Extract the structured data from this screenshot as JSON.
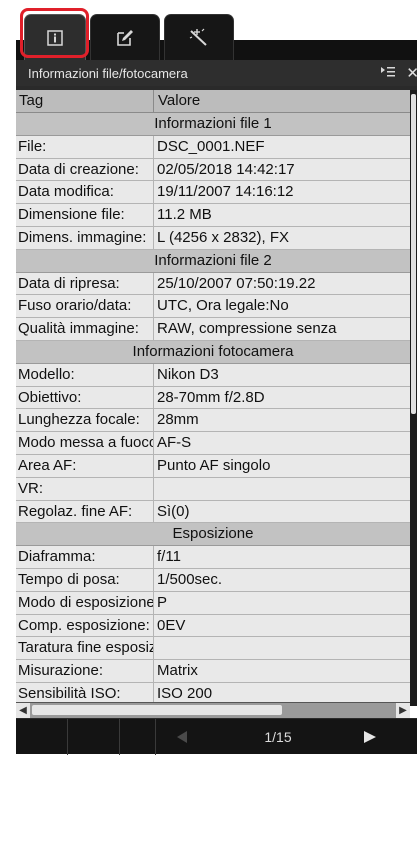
{
  "tabs": [
    {
      "name": "info-tab",
      "icon": "info-icon",
      "selected": true
    },
    {
      "name": "edit-tab",
      "icon": "edit-icon",
      "selected": false
    },
    {
      "name": "adjust-tab",
      "icon": "magic-wand-icon",
      "selected": false
    }
  ],
  "header": {
    "title": "Informazioni file/fotocamera",
    "menu_icon": "list-menu-icon",
    "close_label": "✕"
  },
  "table": {
    "col_tag": "Tag",
    "col_value": "Valore",
    "rows": [
      {
        "type": "section",
        "label": "Informazioni file 1"
      },
      {
        "type": "row",
        "key": "File:",
        "value": "DSC_0001.NEF"
      },
      {
        "type": "row",
        "key": "Data di creazione:",
        "value": "02/05/2018 14:42:17"
      },
      {
        "type": "row",
        "key": "Data modifica:",
        "value": "19/11/2007 14:16:12"
      },
      {
        "type": "row",
        "key": "Dimensione file:",
        "value": "11.2 MB"
      },
      {
        "type": "row",
        "key": "Dimens. immagine:",
        "value": "L (4256 x 2832), FX"
      },
      {
        "type": "section",
        "label": "Informazioni file 2"
      },
      {
        "type": "row",
        "key": "Data di ripresa:",
        "value": "25/10/2007 07:50:19.22"
      },
      {
        "type": "row",
        "key": "Fuso orario/data:",
        "value": "UTC, Ora legale:No"
      },
      {
        "type": "row",
        "key": "Qualità immagine:",
        "value": "RAW, compressione senza"
      },
      {
        "type": "section",
        "label": "Informazioni fotocamera"
      },
      {
        "type": "row",
        "key": "Modello:",
        "value": "Nikon D3"
      },
      {
        "type": "row",
        "key": "Obiettivo:",
        "value": "28-70mm f/2.8D"
      },
      {
        "type": "row",
        "key": "Lunghezza focale:",
        "value": "28mm"
      },
      {
        "type": "row",
        "key": "Modo messa a fuoco:",
        "value": "AF-S"
      },
      {
        "type": "row",
        "key": "Area AF:",
        "value": "Punto AF singolo"
      },
      {
        "type": "row",
        "key": "VR:",
        "value": ""
      },
      {
        "type": "row",
        "key": "Regolaz. fine AF:",
        "value": "Sì(0)"
      },
      {
        "type": "section",
        "label": "Esposizione"
      },
      {
        "type": "row",
        "key": "Diaframma:",
        "value": "f/11"
      },
      {
        "type": "row",
        "key": "Tempo di posa:",
        "value": "1/500sec."
      },
      {
        "type": "row",
        "key": "Modo di esposizione:",
        "value": "P"
      },
      {
        "type": "row",
        "key": "Comp. esposizione:",
        "value": "0EV"
      },
      {
        "type": "row",
        "key": "Taratura fine esposizione:",
        "value": ""
      },
      {
        "type": "row",
        "key": "Misurazione:",
        "value": "Matrix"
      },
      {
        "type": "row",
        "key": "Sensibilità ISO:",
        "value": "ISO 200"
      }
    ]
  },
  "footer": {
    "page": "1/15",
    "prev_icon": "prev-arrow-icon",
    "next_icon": "next-arrow-icon"
  },
  "colors": {
    "callout": "#e0202a",
    "table_bg": "#e9e9e9",
    "section_bg": "#c2c2c2",
    "chrome_dark": "#141414"
  }
}
